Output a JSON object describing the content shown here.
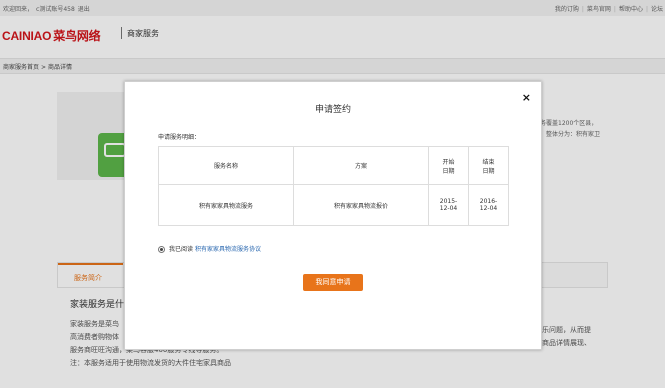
{
  "topbar": {
    "left_items": [
      "欢迎回来，",
      "c测试账号458",
      "退出"
    ],
    "right_items": [
      "我的订购",
      "菜鸟官网",
      "帮助中心",
      "论坛"
    ]
  },
  "header": {
    "logo_en": "CAINIAO",
    "logo_cn": "菜鸟网络",
    "subtitle": "商家服务"
  },
  "breadcrumb": [
    "商家服务首页",
    "商品详情"
  ],
  "product": {
    "side_text_1": "务覆盖1200个区县，",
    "side_text_2": "，整体分为：积有家卫"
  },
  "tabs": {
    "active": "服务简介"
  },
  "content": {
    "heading": "家装服务是什",
    "lines": [
      "家装服务是菜鸟",
      "高消费者购物体",
      "服务商旺旺沟通，菜鸟客服400服务专线等服务。",
      "注：本服务适用于使用物流发货的大件住宅家具商品"
    ],
    "right_frag_1": "乐问题，从而提",
    "right_frag_2": "商品详情展现、"
  },
  "modal": {
    "title": "申请签约",
    "close_label": "×",
    "detail_label": "申请服务明细：",
    "table": {
      "headers": [
        "服务名称",
        "方案",
        "开始\n日期",
        "结束\n日期"
      ],
      "rows": [
        [
          "积有家家具物流服务",
          "积有家家具物流报价",
          "2015-\n12-04",
          "2016-\n12-04"
        ]
      ]
    },
    "agree_text": "我已阅读",
    "agree_link": "积有家家具物流服务协议",
    "submit_label": "我同意申请"
  },
  "colors": {
    "brand_red": "#d4161c",
    "accent_orange": "#e8741a",
    "link_blue": "#2a68b0",
    "product_green": "#5db74a"
  }
}
